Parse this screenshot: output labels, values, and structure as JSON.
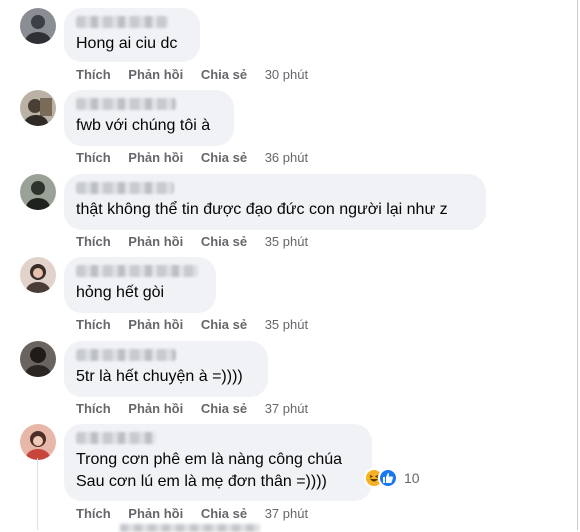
{
  "actions": {
    "like": "Thích",
    "reply": "Phản hồi",
    "share": "Chia sẻ"
  },
  "comments": [
    {
      "text": "Hong ai ciu dc",
      "time": "30 phút",
      "avatar_color": "#5b5f66"
    },
    {
      "text": "fwb với chúng tôi à",
      "time": "36 phút",
      "avatar_color": "#6b5a4a"
    },
    {
      "text": "thật không thể tin được đạo đức con người lại như z",
      "time": "35 phút",
      "avatar_color": "#4a4f48"
    },
    {
      "text": "hỏng hết gòi",
      "time": "35 phút",
      "avatar_color": "#c9a59b"
    },
    {
      "text": "5tr là hết chuyện à =))))",
      "time": "37 phút",
      "avatar_color": "#3f3a38"
    },
    {
      "text_line1": "Trong cơn phê em là nàng công chúa",
      "text_line2": "Sau cơn lú em là mẹ đơn thân =))))",
      "time": "37 phút",
      "avatar_color": "#d68b7a",
      "reaction_count": "10",
      "reaction_icons": [
        "haha-icon",
        "like-icon"
      ]
    }
  ]
}
